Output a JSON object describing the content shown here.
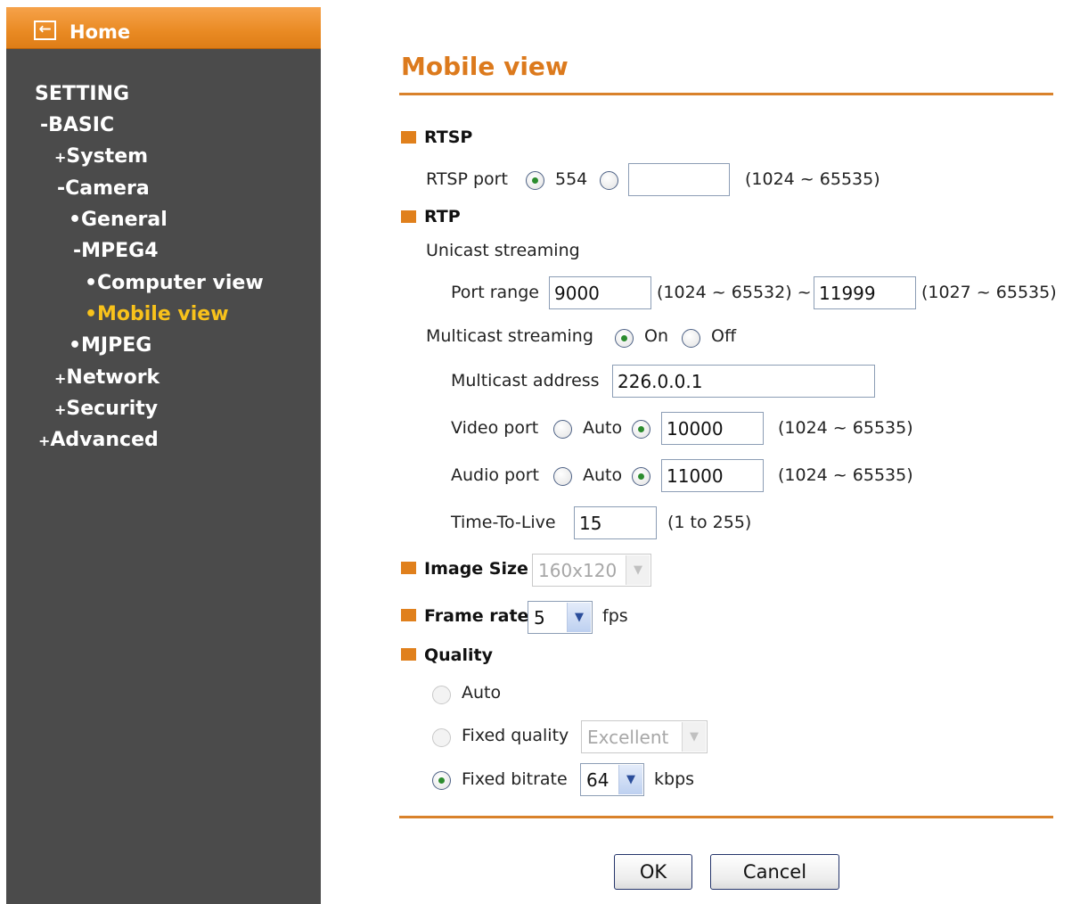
{
  "sidebar": {
    "home": "Home",
    "items": [
      {
        "prefix": "",
        "label": "SETTING"
      },
      {
        "prefix": "-",
        "label": "BASIC"
      },
      {
        "prefix": "+",
        "label": "System"
      },
      {
        "prefix": "-",
        "label": "Camera"
      },
      {
        "prefix": "•",
        "label": "General"
      },
      {
        "prefix": "-",
        "label": "MPEG4"
      },
      {
        "prefix": "•",
        "label": "Computer view"
      },
      {
        "prefix": "•",
        "label": "Mobile view"
      },
      {
        "prefix": "•",
        "label": "MJPEG"
      },
      {
        "prefix": "+",
        "label": "Network"
      },
      {
        "prefix": "+",
        "label": "Security"
      },
      {
        "prefix": "+",
        "label": "Advanced"
      }
    ]
  },
  "page": {
    "title": "Mobile view"
  },
  "rtsp": {
    "section": "RTSP",
    "port_label": "RTSP port",
    "default_port": "554",
    "custom_value": "",
    "range": "(1024 ~ 65535)"
  },
  "rtp": {
    "section": "RTP",
    "unicast_label": "Unicast streaming",
    "port_range_label": "Port range",
    "port_from": "9000",
    "port_from_range": "(1024 ~ 65532) ~",
    "port_to": "11999",
    "port_to_range": "(1027 ~ 65535)",
    "multicast_label": "Multicast streaming",
    "on": "On",
    "off": "Off",
    "multicast_address_label": "Multicast address",
    "multicast_address": "226.0.0.1",
    "video_port_label": "Video port",
    "video_auto": "Auto",
    "video_port": "10000",
    "video_range": "(1024 ~ 65535)",
    "audio_port_label": "Audio port",
    "audio_auto": "Auto",
    "audio_port": "11000",
    "audio_range": "(1024 ~ 65535)",
    "ttl_label": "Time-To-Live",
    "ttl": "15",
    "ttl_range": "(1 to 255)"
  },
  "image_size": {
    "label": "Image Size",
    "value": "160x120"
  },
  "frame_rate": {
    "label": "Frame rate",
    "value": "5",
    "unit": "fps"
  },
  "quality": {
    "label": "Quality",
    "auto": "Auto",
    "fixed_quality": "Fixed quality",
    "fixed_quality_value": "Excellent",
    "fixed_bitrate": "Fixed bitrate",
    "bitrate_value": "64",
    "bitrate_unit": "kbps"
  },
  "buttons": {
    "ok": "OK",
    "cancel": "Cancel"
  },
  "colors": {
    "accent": "#dc7a1d",
    "sidebar_bg": "#4b4b4b",
    "active_item": "#f8c21b"
  }
}
